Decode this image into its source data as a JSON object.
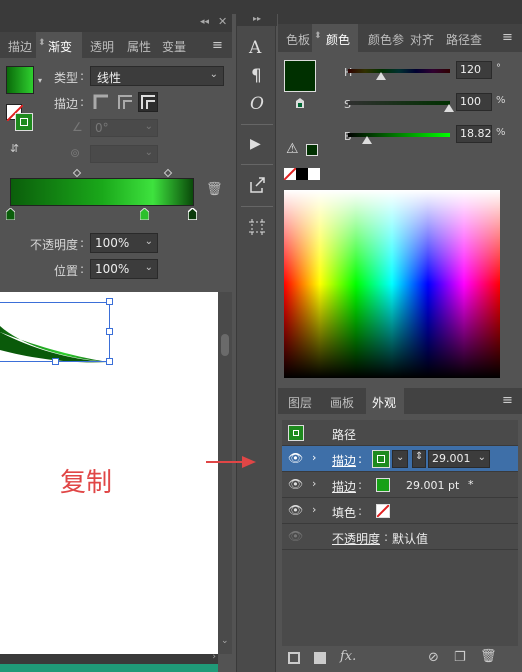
{
  "gradient_panel": {
    "tabs": [
      "描边",
      "渐变",
      "透明",
      "属性",
      "变量"
    ],
    "active_tab": "渐变",
    "type_label": "类型",
    "type_value": "线性",
    "stroke_label": "描边",
    "angle_value": "0°",
    "opacity_label": "不透明度",
    "opacity_value": "100%",
    "position_label": "位置",
    "position_value": "100%"
  },
  "color_panel": {
    "tabs": [
      "色板",
      "颜色",
      "颜色参",
      "对齐",
      "路径查"
    ],
    "active_tab": "颜色",
    "h_label": "H",
    "h_value": "120",
    "h_unit": "°",
    "s_label": "S",
    "s_value": "100",
    "s_unit": "%",
    "b_label": "B",
    "b_value": "18.82",
    "b_unit": "%"
  },
  "appearance_panel": {
    "tabs": [
      "图层",
      "画板",
      "外观"
    ],
    "active_tab": "外观",
    "path_label": "路径",
    "rows": [
      {
        "label": "描边",
        "value": "29.001"
      },
      {
        "label": "描边",
        "value": "29.001 pt"
      },
      {
        "label": "填色",
        "value": ""
      },
      {
        "label": "不透明度",
        "value": "默认值"
      }
    ],
    "asterisk": "*"
  },
  "canvas": {
    "annotation": "复制"
  },
  "colors": {
    "gradient_dark": "#0a5c0a",
    "gradient_bright": "#2fd02f",
    "annotation_red": "#e04646",
    "selection_blue": "#3b6fd8",
    "panel_bg": "#535353",
    "dark_bg": "#323232"
  }
}
